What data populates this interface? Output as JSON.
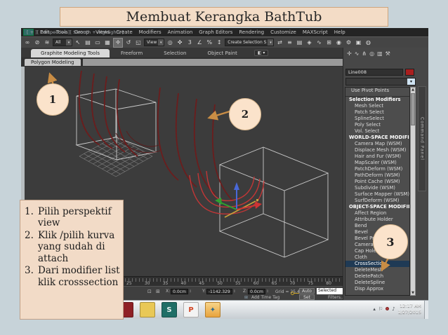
{
  "colors": {
    "slide_bg": "#c7d3d9",
    "panel_peach": "#f3dcc6",
    "callout_fill": "#fbe3cb",
    "callout_arrow": "#c98d45",
    "viewport_bg": "#3c3c3c",
    "selected_row_bg": "#1f3a55",
    "curve_dark_red": "#6b1d1d",
    "curve_selected_red": "#c23636",
    "object_color_swatch": "#a91f1f"
  },
  "slide": {
    "title": "Membuat Kerangka BathTub",
    "notes": [
      {
        "num": "1.",
        "text": "Pilih perspektif view"
      },
      {
        "num": "2.",
        "text": "Klik /pilih kurva yang sudah di attach"
      },
      {
        "num": "3.",
        "text": "Dari modifier list klik crosssection"
      }
    ],
    "callouts": [
      {
        "label": "1"
      },
      {
        "label": "2"
      },
      {
        "label": "3"
      }
    ]
  },
  "max": {
    "menu": [
      "Edit",
      "Tools",
      "Group",
      "Views",
      "Create",
      "Modifiers",
      "Animation",
      "Graph Editors",
      "Rendering",
      "Customize",
      "MAXScript",
      "Help"
    ],
    "toolbar_items": [
      {
        "kind": "icon",
        "name": "select-and-link-icon",
        "text": "∞"
      },
      {
        "kind": "icon",
        "name": "unlink-selection-icon",
        "text": "⊘"
      },
      {
        "kind": "icon",
        "name": "bind-to-space-warp-icon",
        "text": "≋"
      },
      {
        "kind": "dropdown",
        "name": "selection-filter-dropdown",
        "text": "All"
      },
      {
        "kind": "icon",
        "name": "select-object-icon",
        "text": "↖"
      },
      {
        "kind": "icon",
        "name": "select-by-name-icon",
        "text": "▤"
      },
      {
        "kind": "icon",
        "name": "rectangular-region-icon",
        "text": "▭"
      },
      {
        "kind": "icon",
        "name": "window-crossing-icon",
        "text": "▦"
      },
      {
        "kind": "icon-active",
        "name": "select-and-move-icon",
        "text": "✛"
      },
      {
        "kind": "icon",
        "name": "select-and-rotate-icon",
        "text": "↺"
      },
      {
        "kind": "icon",
        "name": "select-and-scale-icon",
        "text": "◱"
      },
      {
        "kind": "dropdown",
        "name": "reference-coordinate-system-dropdown",
        "text": "View"
      },
      {
        "kind": "icon",
        "name": "use-pivot-point-center-icon",
        "text": "◎"
      },
      {
        "kind": "icon",
        "name": "select-and-manipulate-icon",
        "text": "✜"
      },
      {
        "kind": "icon",
        "name": "snaps-toggle-icon",
        "text": "3"
      },
      {
        "kind": "icon",
        "name": "angle-snap-icon",
        "text": "∠"
      },
      {
        "kind": "icon",
        "name": "percent-snap-icon",
        "text": "%"
      },
      {
        "kind": "icon",
        "name": "spinner-snap-icon",
        "text": "↕"
      },
      {
        "kind": "dropdown",
        "name": "named-selection-set-dropdown",
        "text": "Create Selection S"
      },
      {
        "kind": "icon",
        "name": "mirror-icon",
        "text": "⇄"
      },
      {
        "kind": "icon",
        "name": "align-icon",
        "text": "≡"
      },
      {
        "kind": "icon",
        "name": "layer-manager-icon",
        "text": "▤"
      },
      {
        "kind": "icon",
        "name": "graphite-ribbon-toggle-icon",
        "text": "◈"
      },
      {
        "kind": "icon",
        "name": "curve-editor-icon",
        "text": "∿"
      },
      {
        "kind": "icon",
        "name": "schematic-view-icon",
        "text": "⊞"
      },
      {
        "kind": "icon",
        "name": "material-editor-icon",
        "text": "◉"
      },
      {
        "kind": "icon",
        "name": "render-setup-icon",
        "text": "⚙"
      },
      {
        "kind": "icon",
        "name": "rendered-frame-window-icon",
        "text": "▣"
      },
      {
        "kind": "icon",
        "name": "render-production-icon",
        "text": "◍"
      }
    ],
    "ribbon": {
      "tabs": [
        {
          "label": "Graphite Modeling Tools",
          "kind": "active"
        },
        {
          "label": "Freeform",
          "kind": "tab"
        },
        {
          "label": "Selection",
          "kind": "tab"
        },
        {
          "label": "Object Paint",
          "kind": "tab"
        }
      ],
      "options_icon": "◧ ▾",
      "subtab": "Polygon Modeling"
    },
    "viewport": {
      "label": "[ + ][ Perspective ][ Smooth + Highlights ]"
    },
    "command_panel": {
      "tabs": [
        {
          "name": "create-tab-icon",
          "glyph": "✛"
        },
        {
          "name": "modify-tab-icon",
          "glyph": "∿"
        },
        {
          "name": "hierarchy-tab-icon",
          "glyph": "⋔"
        },
        {
          "name": "motion-tab-icon",
          "glyph": "◎"
        },
        {
          "name": "display-tab-icon",
          "glyph": "▥"
        },
        {
          "name": "utilities-tab-icon",
          "glyph": "⚒"
        }
      ],
      "object_name": "Line008",
      "combo_caret": "▾",
      "scroll_up": "▲",
      "scroll_down": "▼",
      "panel_tab_label": "Command Panel",
      "modifier_rows": [
        {
          "kind": "top",
          "label": "Use Pivot Points"
        },
        {
          "kind": "separator",
          "label": ""
        },
        {
          "kind": "header",
          "label": "Selection Modifiers"
        },
        {
          "kind": "item",
          "label": "Mesh Select"
        },
        {
          "kind": "item",
          "label": "Patch Select"
        },
        {
          "kind": "item",
          "label": "SplineSelect"
        },
        {
          "kind": "item",
          "label": "Poly Select"
        },
        {
          "kind": "item",
          "label": "Vol. Select"
        },
        {
          "kind": "header",
          "label": "WORLD-SPACE MODIFIERS"
        },
        {
          "kind": "item",
          "label": "Camera Map (WSM)"
        },
        {
          "kind": "item",
          "label": "Displace Mesh (WSM)"
        },
        {
          "kind": "item",
          "label": "Hair and Fur (WSM)"
        },
        {
          "kind": "item",
          "label": "MapScaler (WSM)"
        },
        {
          "kind": "item",
          "label": "PatchDeform (WSM)"
        },
        {
          "kind": "item",
          "label": "PathDeform (WSM)"
        },
        {
          "kind": "item",
          "label": "Point Cache (WSM)"
        },
        {
          "kind": "item",
          "label": "Subdivide (WSM)"
        },
        {
          "kind": "item",
          "label": "Surface Mapper (WSM)"
        },
        {
          "kind": "item",
          "label": "SurfDeform (WSM)"
        },
        {
          "kind": "header",
          "label": "OBJECT-SPACE MODIFIERS"
        },
        {
          "kind": "item",
          "label": "Affect Region"
        },
        {
          "kind": "item",
          "label": "Attribute Holder"
        },
        {
          "kind": "item",
          "label": "Bend"
        },
        {
          "kind": "item",
          "label": "Bevel"
        },
        {
          "kind": "item",
          "label": "Bevel Profile"
        },
        {
          "kind": "item",
          "label": "Camera Map"
        },
        {
          "kind": "item",
          "label": "Cap Holes"
        },
        {
          "kind": "item",
          "label": "Cloth"
        },
        {
          "kind": "selected",
          "label": "CrossSection"
        },
        {
          "kind": "item",
          "label": "DeleteMesh"
        },
        {
          "kind": "item",
          "label": "DeletePatch"
        },
        {
          "kind": "item",
          "label": "DeleteSpline"
        },
        {
          "kind": "item",
          "label": "Disp Approx"
        }
      ]
    },
    "timeline": {
      "ticks": [
        "25",
        "30",
        "35",
        "40",
        "45",
        "50",
        "55",
        "60",
        "65",
        "70",
        "75",
        "80"
      ]
    },
    "status_bar": {
      "lock_icon": "⊡",
      "xref_icon": "⊞",
      "x_label": "X:",
      "x_value": "0.0cm",
      "y_label": "Y:",
      "y_value": "-1142.329",
      "z_label": "Z:",
      "z_value": "0.0cm",
      "spinner": "↕",
      "grid_text": "Grid = 25.4cm",
      "add_time_tag_icon": "⊞",
      "add_time_tag": "Add Time Tag",
      "auto_button": "Auto",
      "set_key_button": "Set K...",
      "selected_dropdown": "Selected",
      "filters_text": "Filters..."
    },
    "taskbar": {
      "tiles": [
        {
          "name": "taskbar-app-1",
          "glyph": ""
        },
        {
          "name": "taskbar-app-folder",
          "glyph": ""
        },
        {
          "name": "taskbar-app-2",
          "glyph": "S"
        },
        {
          "name": "taskbar-app-powerpoint",
          "glyph": "P"
        },
        {
          "name": "taskbar-app-3dsmax-active",
          "glyph": "✦"
        }
      ],
      "tray_hide_icon": "▴",
      "tray_flag_icon": "⚐",
      "tray_sound_icon": "♪",
      "clock_time": "12:17 AM",
      "clock_date": "1/27/2015"
    }
  }
}
